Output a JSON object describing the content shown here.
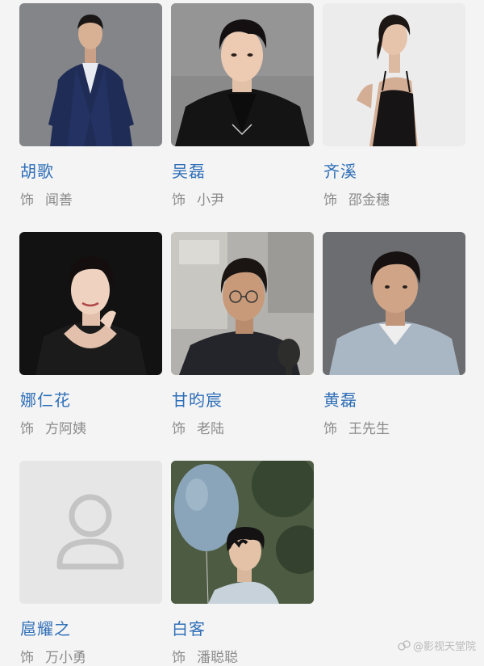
{
  "role_prefix": "饰",
  "cast": [
    {
      "actor": "胡歌",
      "character": "闻善",
      "photo": "actor-photo-man-navy-suit"
    },
    {
      "actor": "吴磊",
      "character": "小尹",
      "photo": "actor-photo-young-man-black-jacket"
    },
    {
      "actor": "齐溪",
      "character": "邵金穗",
      "photo": "actor-photo-woman-black-dress"
    },
    {
      "actor": "娜仁花",
      "character": "方阿姨",
      "photo": "actor-photo-woman-black-background"
    },
    {
      "actor": "甘昀宸",
      "character": "老陆",
      "photo": "actor-photo-man-glasses-microphone"
    },
    {
      "actor": "黄磊",
      "character": "王先生",
      "photo": "actor-photo-man-grey-background"
    },
    {
      "actor": "扈耀之",
      "character": "万小勇",
      "photo": "placeholder-person-icon"
    },
    {
      "actor": "白客",
      "character": "潘聪聪",
      "photo": "actor-photo-man-with-balloon"
    }
  ],
  "watermark": "@影视天堂院",
  "colors": {
    "actor_name": "#2f6fb8",
    "role_text": "#8b8b8b",
    "background": "#f4f4f4"
  }
}
